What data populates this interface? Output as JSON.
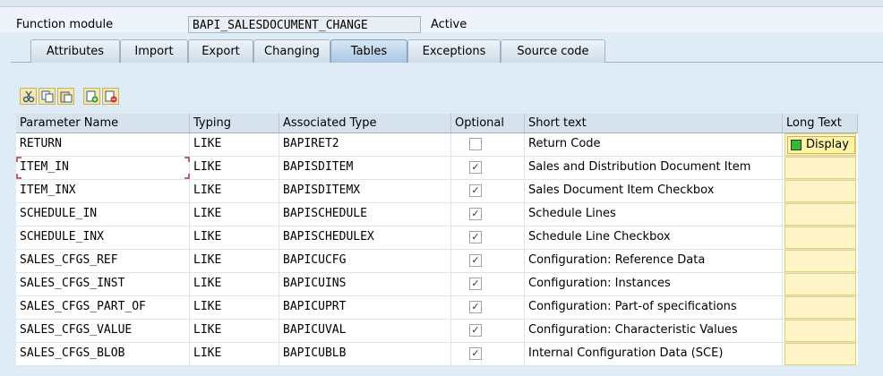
{
  "header": {
    "label": "Function module",
    "value": "BAPI_SALESDOCUMENT_CHANGE",
    "status": "Active"
  },
  "tabs": [
    {
      "label": "Attributes",
      "active": false
    },
    {
      "label": "Import",
      "active": false
    },
    {
      "label": "Export",
      "active": false
    },
    {
      "label": "Changing",
      "active": false
    },
    {
      "label": "Tables",
      "active": true
    },
    {
      "label": "Exceptions",
      "active": false
    },
    {
      "label": "Source code",
      "active": false
    }
  ],
  "toolbar": {
    "icons": [
      "cut-icon",
      "copy-icon",
      "paste-icon",
      "insert-row-icon",
      "delete-row-icon"
    ]
  },
  "grid": {
    "columns": [
      "Parameter Name",
      "Typing",
      "Associated Type",
      "Optional",
      "Short text",
      "Long Text"
    ],
    "rows": [
      {
        "name": "RETURN",
        "typing": "LIKE",
        "type": "BAPIRET2",
        "optional": false,
        "short": "Return Code",
        "long": "Display"
      },
      {
        "name": "ITEM_IN",
        "typing": "LIKE",
        "type": "BAPISDITEM",
        "optional": true,
        "short": "Sales and Distribution Document Item",
        "long": ""
      },
      {
        "name": "ITEM_INX",
        "typing": "LIKE",
        "type": "BAPISDITEMX",
        "optional": true,
        "short": "Sales Document Item Checkbox",
        "long": ""
      },
      {
        "name": "SCHEDULE_IN",
        "typing": "LIKE",
        "type": "BAPISCHEDULE",
        "optional": true,
        "short": "Schedule Lines",
        "long": ""
      },
      {
        "name": "SCHEDULE_INX",
        "typing": "LIKE",
        "type": "BAPISCHEDULEX",
        "optional": true,
        "short": "Schedule Line Checkbox",
        "long": ""
      },
      {
        "name": "SALES_CFGS_REF",
        "typing": "LIKE",
        "type": "BAPICUCFG",
        "optional": true,
        "short": "Configuration: Reference Data",
        "long": ""
      },
      {
        "name": "SALES_CFGS_INST",
        "typing": "LIKE",
        "type": "BAPICUINS",
        "optional": true,
        "short": "Configuration: Instances",
        "long": ""
      },
      {
        "name": "SALES_CFGS_PART_OF",
        "typing": "LIKE",
        "type": "BAPICUPRT",
        "optional": true,
        "short": "Configuration: Part-of specifications",
        "long": ""
      },
      {
        "name": "SALES_CFGS_VALUE",
        "typing": "LIKE",
        "type": "BAPICUVAL",
        "optional": true,
        "short": "Configuration: Characteristic Values",
        "long": ""
      },
      {
        "name": "SALES_CFGS_BLOB",
        "typing": "LIKE",
        "type": "BAPICUBLB",
        "optional": true,
        "short": "Internal Configuration Data (SCE)",
        "long": ""
      }
    ]
  }
}
